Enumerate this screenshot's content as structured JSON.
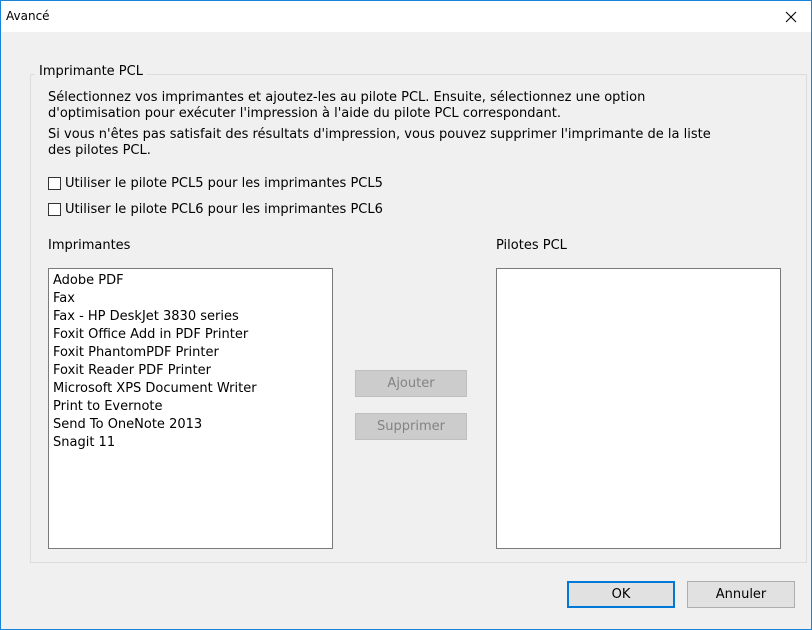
{
  "window": {
    "title": "Avancé",
    "close_icon": "close-icon"
  },
  "group": {
    "legend": "Imprimante PCL",
    "description1_line1": "Sélectionnez vos imprimantes et ajoutez-les au pilote PCL. Ensuite, sélectionnez une option",
    "description1_line2": "d'optimisation pour exécuter l'impression à l'aide du pilote PCL correspondant.",
    "description2_line1": "Si vous n'êtes pas satisfait des résultats d'impression, vous pouvez supprimer l'imprimante de la liste",
    "description2_line2": "des pilotes PCL.",
    "checkbox_pcl5": {
      "label": "Utiliser le pilote PCL5 pour les imprimantes PCL5",
      "checked": false
    },
    "checkbox_pcl6": {
      "label": "Utiliser le pilote PCL6 pour les imprimantes PCL6",
      "checked": false
    }
  },
  "printers": {
    "label": "Imprimantes",
    "items": [
      "Adobe PDF",
      "Fax",
      "Fax - HP DeskJet 3830 series",
      "Foxit Office Add in PDF Printer",
      "Foxit PhantomPDF Printer",
      "Foxit Reader PDF Printer",
      "Microsoft XPS Document Writer",
      "Print to Evernote",
      "Send To OneNote 2013",
      "Snagit 11"
    ]
  },
  "pcl_drivers": {
    "label": "Pilotes PCL",
    "items": []
  },
  "actions": {
    "add_label": "Ajouter",
    "remove_label": "Supprimer"
  },
  "footer": {
    "ok_label": "OK",
    "cancel_label": "Annuler"
  },
  "colors": {
    "window_border": "#1883d7",
    "default_button_border": "#0078d7",
    "disabled_button_bg": "#cccccc",
    "disabled_text": "#838383"
  }
}
